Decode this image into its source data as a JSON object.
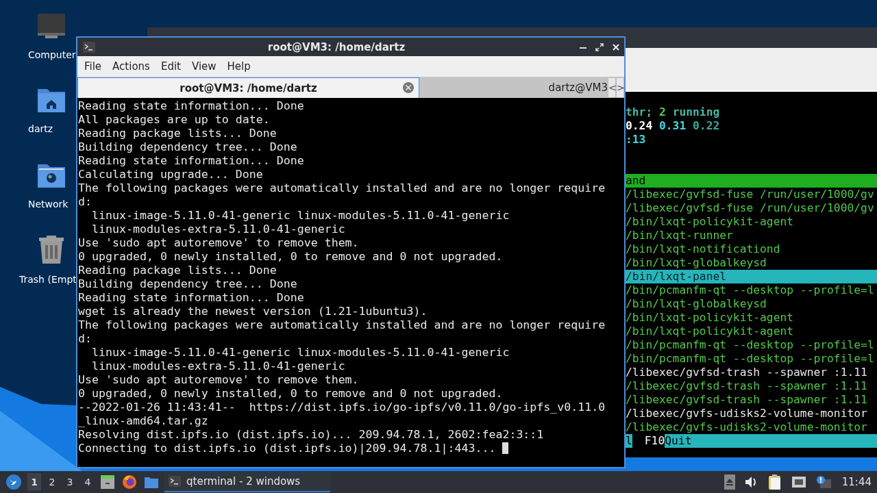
{
  "desktop_icons": [
    {
      "kind": "computer",
      "label": "Computer"
    },
    {
      "kind": "home",
      "label": "dartz"
    },
    {
      "kind": "network",
      "label": "Network"
    },
    {
      "kind": "trash",
      "label": "Trash (Empt"
    }
  ],
  "back_window": {
    "summary": [
      [
        {
          "text": "thr; ",
          "color": "#44b8a8"
        },
        {
          "text": "2",
          "color": "#4fd04f"
        },
        {
          "text": " running",
          "color": "#44b8a8"
        }
      ],
      [
        {
          "text": "0.24 ",
          "color": "#ffffff"
        },
        {
          "text": "0.31 ",
          "color": "#40d8e0"
        },
        {
          "text": "0.22",
          "color": "#3aa9a0"
        }
      ],
      [
        {
          "text": ":13",
          "color": "#40d8e0"
        }
      ]
    ],
    "header": "and",
    "processes": [
      {
        "text": "/libexec/gvfsd-fuse /run/user/1000/gv",
        "color": "#52c84a",
        "selected": false
      },
      {
        "text": "/libexec/gvfsd-fuse /run/user/1000/gv",
        "color": "#52c84a",
        "selected": false
      },
      {
        "text": "/bin/lxqt-policykit-agent",
        "color": "#52c84a",
        "selected": false
      },
      {
        "text": "/bin/lxqt-runner",
        "color": "#52c84a",
        "selected": false
      },
      {
        "text": "/bin/lxqt-notificationd",
        "color": "#52c84a",
        "selected": false
      },
      {
        "text": "/bin/lxqt-globalkeysd",
        "color": "#52c84a",
        "selected": false
      },
      {
        "text": "/bin/lxqt-panel",
        "selected": true
      },
      {
        "text": "/bin/pcmanfm-qt --desktop --profile=l",
        "color": "#52c84a",
        "selected": false
      },
      {
        "text": "/bin/lxqt-globalkeysd",
        "color": "#52c84a",
        "selected": false
      },
      {
        "text": "/bin/lxqt-policykit-agent",
        "color": "#52c84a",
        "selected": false
      },
      {
        "text": "/bin/lxqt-policykit-agent",
        "color": "#52c84a",
        "selected": false
      },
      {
        "text": "/bin/pcmanfm-qt --desktop --profile=l",
        "color": "#52c84a",
        "selected": false
      },
      {
        "text": "/bin/pcmanfm-qt --desktop --profile=l",
        "color": "#52c84a",
        "selected": false
      },
      {
        "text": "/libexec/gvfsd-trash --spawner :1.11",
        "color": "#e6e6e6",
        "selected": false
      },
      {
        "text": "/libexec/gvfsd-trash --spawner :1.11",
        "color": "#52c84a",
        "selected": false
      },
      {
        "text": "/libexec/gvfsd-trash --spawner :1.11",
        "color": "#52c84a",
        "selected": false
      },
      {
        "text": "/libexec/gvfs-udisks2-volume-monitor",
        "color": "#e6e6e6",
        "selected": false
      },
      {
        "text": "/libexec/gvfs-udisks2-volume-monitor",
        "color": "#52c84a",
        "selected": false
      }
    ],
    "footer": [
      {
        "text": "l",
        "kind": "label"
      },
      {
        "text": "F10",
        "kind": "key"
      },
      {
        "text": "Quit",
        "kind": "label"
      }
    ]
  },
  "window": {
    "title": "root@VM3: /home/dartz",
    "menu": [
      "File",
      "Actions",
      "Edit",
      "View",
      "Help"
    ],
    "tabs": [
      {
        "label": "root@VM3: /home/dartz",
        "selected": true
      },
      {
        "label": "dartz@VM3",
        "selected": false
      }
    ],
    "tab_scroll": [
      "<",
      ">"
    ],
    "terminal": {
      "lines": [
        "Reading state information... Done",
        "All packages are up to date.",
        "Reading package lists... Done",
        "Building dependency tree... Done",
        "Reading state information... Done",
        "Calculating upgrade... Done",
        "The following packages were automatically installed and are no longer require",
        "d:",
        "  linux-image-5.11.0-41-generic linux-modules-5.11.0-41-generic",
        "  linux-modules-extra-5.11.0-41-generic",
        "Use 'sudo apt autoremove' to remove them.",
        "0 upgraded, 0 newly installed, 0 to remove and 0 not upgraded.",
        "Reading package lists... Done",
        "Building dependency tree... Done",
        "Reading state information... Done",
        "wget is already the newest version (1.21-1ubuntu3).",
        "The following packages were automatically installed and are no longer require",
        "d:",
        "  linux-image-5.11.0-41-generic linux-modules-5.11.0-41-generic",
        "  linux-modules-extra-5.11.0-41-generic",
        "Use 'sudo apt autoremove' to remove them.",
        "0 upgraded, 0 newly installed, 0 to remove and 0 not upgraded.",
        "--2022-01-26 11:43:41--  https://dist.ipfs.io/go-ipfs/v0.11.0/go-ipfs_v0.11.0",
        "_linux-amd64.tar.gz",
        "Resolving dist.ipfs.io (dist.ipfs.io)... 209.94.78.1, 2602:fea2:3::1",
        "Connecting to dist.ipfs.io (dist.ipfs.io)|209.94.78.1|:443... "
      ],
      "cursor": true
    }
  },
  "taskbar": {
    "workspaces": [
      {
        "label": "1",
        "selected": true
      },
      {
        "label": "2",
        "selected": false
      },
      {
        "label": "3",
        "selected": false
      },
      {
        "label": "4",
        "selected": false
      }
    ],
    "tasks": [
      {
        "label": "qterminal - 2 windows",
        "selected": true
      }
    ],
    "clock": "11:44"
  }
}
